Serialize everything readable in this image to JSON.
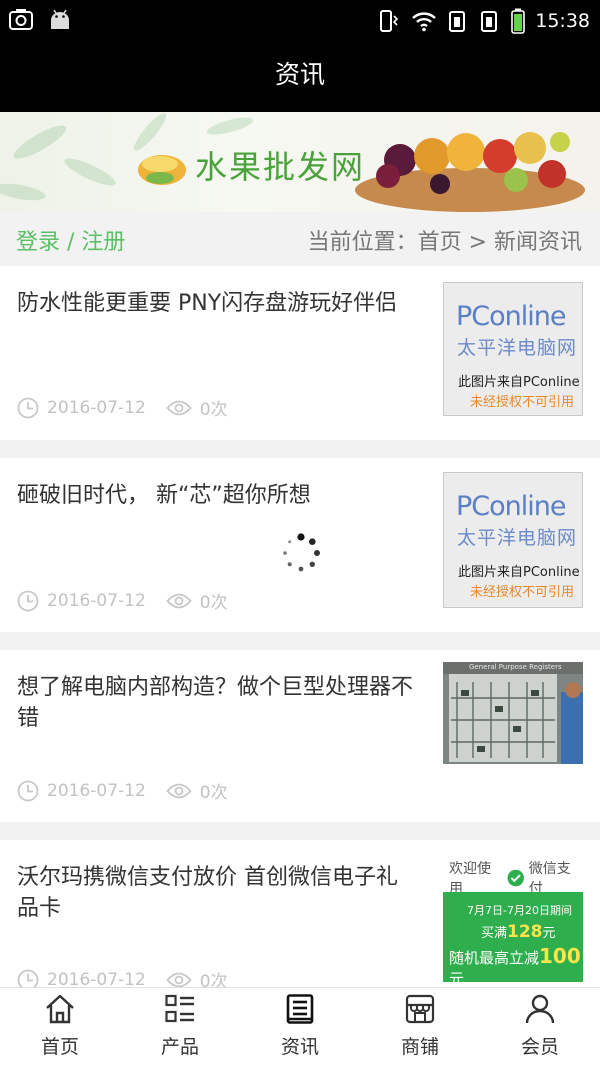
{
  "status_bar": {
    "time": "15:38"
  },
  "header": {
    "title": "资讯"
  },
  "banner": {
    "brand": "水果批发网"
  },
  "crumb_bar": {
    "login": "登录 / 注册",
    "location": "当前位置：首页 > 新闻资讯"
  },
  "news": [
    {
      "title": "防水性能更重要 PNY闪存盘游玩好伴侣",
      "date": "2016-07-12",
      "views": "0次",
      "thumb": {
        "logo": "PConline",
        "logo_cn": "太平洋电脑网",
        "source": "此图片来自PConline",
        "warning": "未经授权不可引用"
      }
    },
    {
      "title": "砸破旧时代， 新“芯”超你所想",
      "date": "2016-07-12",
      "views": "0次",
      "thumb": {
        "logo": "PConline",
        "logo_cn": "太平洋电脑网",
        "source": "此图片来自PConline",
        "warning": "未经授权不可引用"
      }
    },
    {
      "title": "想了解电脑内部构造？做个巨型处理器不错",
      "date": "2016-07-12",
      "views": "0次",
      "thumb": {
        "caption": "General Purpose Registers"
      }
    },
    {
      "title": "沃尔玛携微信支付放价 首创微信电子礼品卡",
      "date": "2016-07-12",
      "views": "0次",
      "thumb": {
        "welcome": "欢迎使用",
        "pay": "微信支付",
        "period": "7月7日-7月20日期间",
        "full": "买满",
        "amount1": "128",
        "yuan": "元",
        "random": "随机最高立减",
        "amount2": "100"
      }
    }
  ],
  "tabs": [
    {
      "label": "首页",
      "icon": "home-icon"
    },
    {
      "label": "产品",
      "icon": "grid-list-icon"
    },
    {
      "label": "资讯",
      "icon": "newspaper-icon"
    },
    {
      "label": "商铺",
      "icon": "store-icon"
    },
    {
      "label": "会员",
      "icon": "user-icon"
    }
  ],
  "colors": {
    "accent_green": "#5cc066",
    "header_bg": "#000000",
    "meta_gray": "#c2c2c2"
  }
}
